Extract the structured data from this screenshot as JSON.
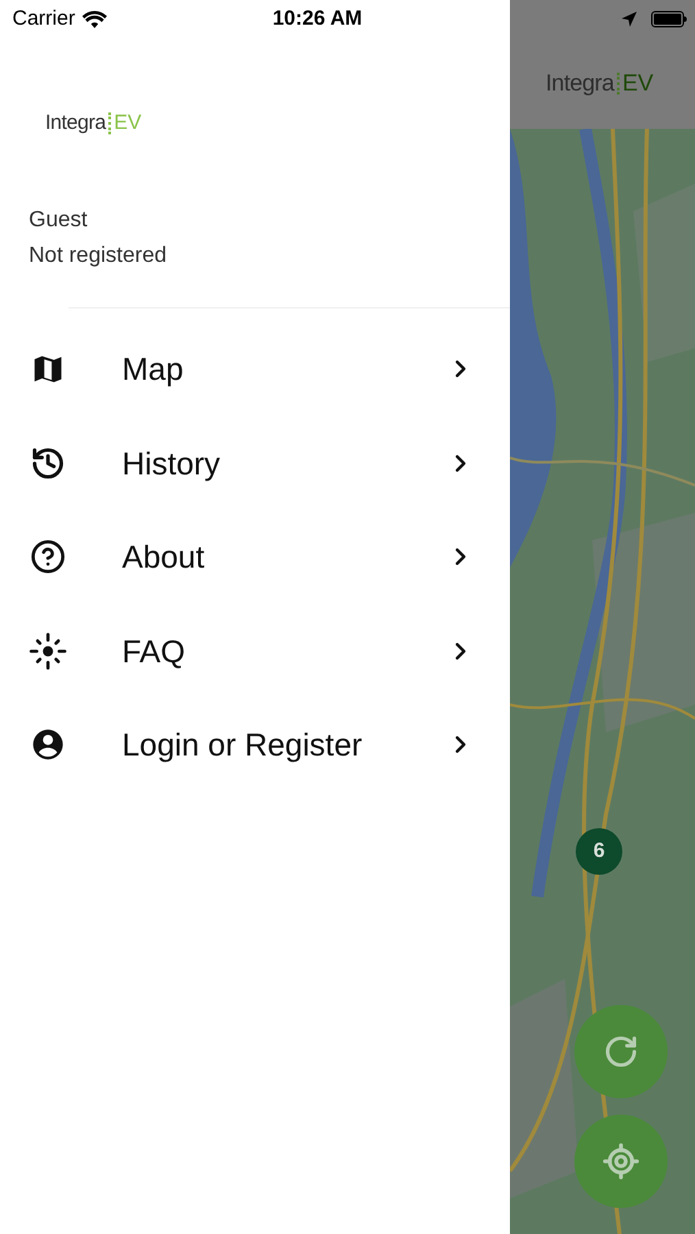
{
  "status_bar": {
    "carrier": "Carrier",
    "time": "10:26 AM"
  },
  "drawer": {
    "logo": {
      "name": "Integra",
      "suffix": "EV"
    },
    "user": {
      "name": "Guest",
      "status": "Not registered"
    },
    "menu": [
      {
        "label": "Map"
      },
      {
        "label": "History"
      },
      {
        "label": "About"
      },
      {
        "label": "FAQ"
      },
      {
        "label": "Login or Register"
      }
    ]
  },
  "background": {
    "header_logo": {
      "name": "Integra",
      "suffix": "EV"
    },
    "cluster": "6"
  }
}
